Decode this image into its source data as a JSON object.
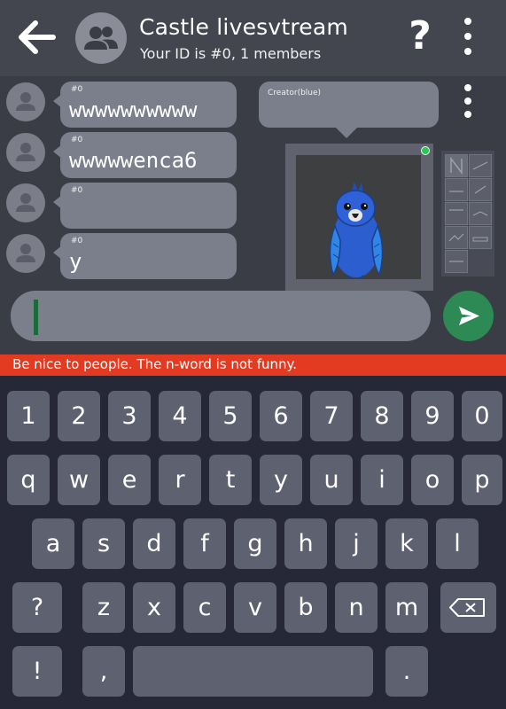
{
  "header": {
    "title": "Castle livesvtream",
    "subtitle": "Your ID is #0, 1 members",
    "help_label": "?"
  },
  "messages": [
    {
      "sender": "#0",
      "text": "wwwwwwwwww"
    },
    {
      "sender": "#0",
      "text": "wwwwwenca6"
    },
    {
      "sender": "#0",
      "text": ""
    },
    {
      "sender": "#0",
      "text": "y"
    }
  ],
  "stage": {
    "creator_label": "Creator(blue)",
    "online_color": "#2fc35b"
  },
  "input": {
    "value": ""
  },
  "notice": {
    "text": "Be nice to people. The n-word is not funny."
  },
  "keyboard": {
    "numbers": [
      "1",
      "2",
      "3",
      "4",
      "5",
      "6",
      "7",
      "8",
      "9",
      "0"
    ],
    "row1": [
      "q",
      "w",
      "e",
      "r",
      "t",
      "y",
      "u",
      "i",
      "o",
      "p"
    ],
    "row2": [
      "a",
      "s",
      "d",
      "f",
      "g",
      "h",
      "j",
      "k",
      "l"
    ],
    "row3": [
      "?",
      "z",
      "x",
      "c",
      "v",
      "b",
      "n",
      "m"
    ],
    "bottom": [
      "!",
      ",",
      "."
    ]
  },
  "colors": {
    "accent_green": "#2e8a55",
    "notice_red": "#e23b21",
    "bubble": "#7b7f8c"
  }
}
